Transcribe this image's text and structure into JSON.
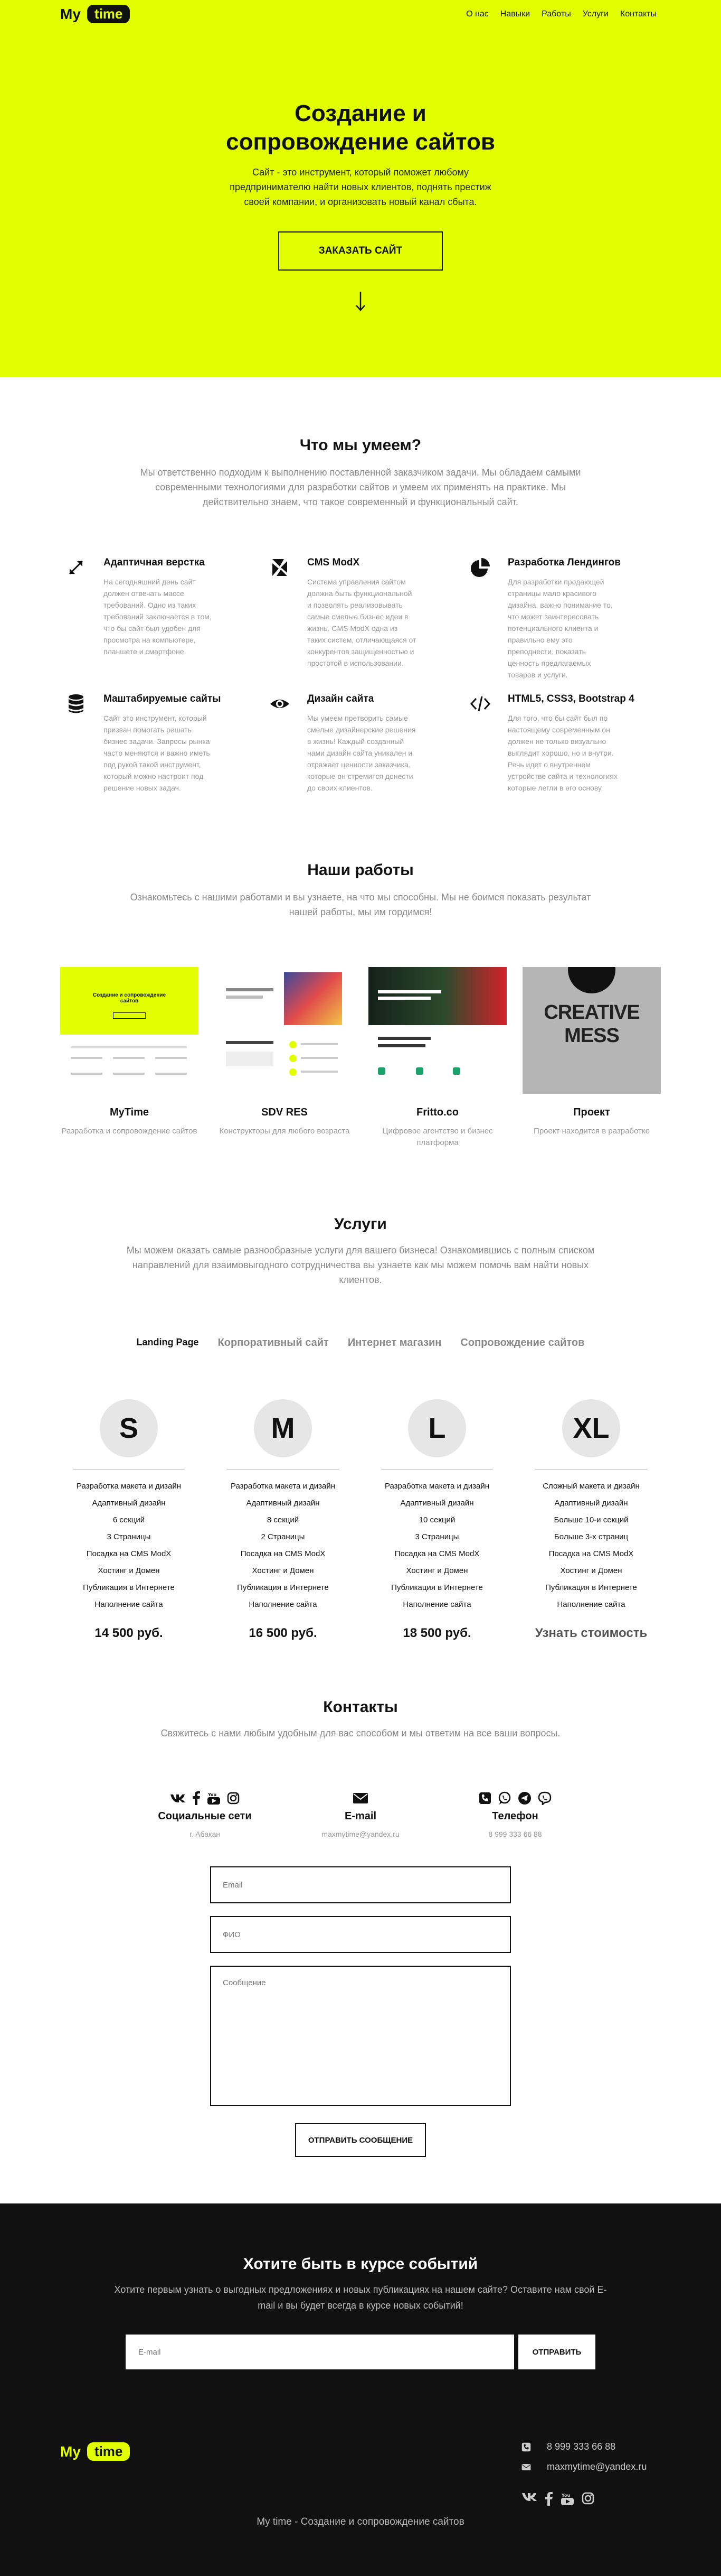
{
  "header": {
    "logo_my": "My",
    "logo_time": "time",
    "nav": [
      "О нас",
      "Навыки",
      "Работы",
      "Услуги",
      "Контакты"
    ]
  },
  "hero": {
    "title_line1": "Создание и",
    "title_line2": "сопровождение сайтов",
    "subtitle": "Сайт - это инструмент, который поможет любому предпринимателю найти новых клиентов, поднять престиж своей компании, и организовать новый канал сбыта.",
    "cta": "ЗАКАЗАТЬ САЙТ",
    "arrow_icon": "arrow-down-icon"
  },
  "skills": {
    "title": "Что мы умеем?",
    "subtitle": "Мы ответственно подходим к выполнению поставленной заказчиком задачи. Мы обладаем самыми современными технологиями для разработки сайтов и умеем их применять на практике. Мы действительно знаем, что такое современный и функциональный сайт.",
    "items": [
      {
        "icon": "expand-arrows-icon",
        "title": "Адаптичная верстка",
        "text": "На сегодняшний день сайт должен отвечать массе требований. Одно из таких требований заключается в том, что бы сайт был удобен для просмотра на компьютере, планшете и смартфоне."
      },
      {
        "icon": "modx-icon",
        "title": "CMS ModX",
        "text": "Система управления сайтом должна быть функциональной и позволять реализовывать самые смелые бизнес идеи в жизнь. CMS ModX одна из таких систем, отличающаяся от конкурентов защищенностью и простотой в использовании."
      },
      {
        "icon": "pie-chart-icon",
        "title": "Разработка Лендингов",
        "text": "Для разработки продающей страницы мало красивого дизайна, важно понимание то, что может заинтересовать потенциального клиента и правильно ему это преподнести, показать ценность предлагаемых товаров и услуги."
      },
      {
        "icon": "database-icon",
        "title": "Маштабируемые сайты",
        "text": "Сайт это инструмент, который призван помогать решать бизнес задачи. Запросы рынка часто меняются и важно иметь под рукой такой инструмент, который можно настроит под решение новых задач."
      },
      {
        "icon": "eye-icon",
        "title": "Дизайн сайта",
        "text": "Мы умеем претворить самые смелые дизайнерские решения в жизнь! Каждый созданный нами дизайн сайта уникален и отражает ценности заказчика, которые он стремится донести до своих клиентов."
      },
      {
        "icon": "code-icon",
        "title": "HTML5, CSS3, Bootstrap 4",
        "text": "Для того, что бы сайт был по настоящему современным он должен не только визуально выглядит хорошо, но и внутри. Речь идет о внутреннем устройстве сайта и технологиях которые легли в его основу."
      }
    ]
  },
  "works": {
    "title": "Наши работы",
    "subtitle": "Ознакомьтесь с нашими работами и вы узнаете, на что мы способны. Мы не боимся показать результат нашей работы, мы им гордимся!",
    "items": [
      {
        "name": "MyTime",
        "desc": "Разработка и сопровождение сайтов",
        "thumb_title": "Создание и сопровождение сайтов"
      },
      {
        "name": "SDV RES",
        "desc": "Конструкторы для любого возраста",
        "thumb_title": ""
      },
      {
        "name": "Fritto.co",
        "desc": "Цифровое агентство и бизнес платформа",
        "thumb_title": ""
      },
      {
        "name": "Проект",
        "desc": "Проект находится в разработке",
        "thumb_title": "CREATIVE MESS"
      }
    ]
  },
  "services": {
    "title": "Услуги",
    "subtitle": "Мы можем оказать самые разнообразные услуги для вашего бизнеса! Ознакомившись с полным списком направлений для взаимовыгодного сотрудничества вы узнаете как мы можем помочь вам найти новых клиентов.",
    "tabs": [
      "Landing Page",
      "Корпоративный сайт",
      "Интернет магазин",
      "Сопровождение сайтов"
    ],
    "plans": [
      {
        "size": "S",
        "items": [
          "Разработка макета и дизайн",
          "Адаптивный дизайн",
          "6 секций",
          "3 Страницы",
          "Посадка на CMS ModX",
          "Хостинг и Домен",
          "Публикация в Интернете",
          "Наполнение сайта"
        ],
        "price": "14 500 руб."
      },
      {
        "size": "M",
        "items": [
          "Разработка макета и дизайн",
          "Адаптивный дизайн",
          "8 секций",
          "2 Страницы",
          "Посадка на CMS ModX",
          "Хостинг и Домен",
          "Публикация в Интернете",
          "Наполнение сайта"
        ],
        "price": "16 500 руб."
      },
      {
        "size": "L",
        "items": [
          "Разработка макета и дизайн",
          "Адаптивный дизайн",
          "10 секций",
          "3 Страницы",
          "Посадка на CMS ModX",
          "Хостинг и Домен",
          "Публикация в Интернете",
          "Наполнение сайта"
        ],
        "price": "18 500 руб."
      },
      {
        "size": "XL",
        "items": [
          "Сложный макета и дизайн",
          "Адаптивный дизайн",
          "Больше 10-и секций",
          "Больше 3-х страниц",
          "Посадка на CMS ModX",
          "Хостинг и Домен",
          "Публикация в Интернете",
          "Наполнение сайта"
        ],
        "price": "Узнать стоимость"
      }
    ]
  },
  "contacts": {
    "title": "Контакты",
    "subtitle": "Свяжитесь с нами любым удобным для вас способом и мы ответим на все ваши вопросы.",
    "social": {
      "title": "Социальные сети",
      "value": "г. Абакан",
      "icons": [
        "vk-icon",
        "facebook-icon",
        "youtube-icon",
        "instagram-icon"
      ]
    },
    "email": {
      "title": "E-mail",
      "value": "maxmytime@yandex.ru",
      "icon": "envelope-icon"
    },
    "phone": {
      "title": "Телефон",
      "value": "8 999 333 66 88",
      "icons": [
        "phone-icon",
        "whatsapp-icon",
        "telegram-icon",
        "viber-icon"
      ]
    },
    "form": {
      "email_placeholder": "Email",
      "name_placeholder": "ФИО",
      "message_placeholder": "Сообщение",
      "submit": "ОТПРАВИТЬ СООБЩЕНИЕ"
    }
  },
  "newsletter": {
    "title": "Хотите быть в курсе событий",
    "subtitle": "Хотите первым узнать о выгодных предложениях и новых публикациях на нашем сайте? Оставите нам свой E-mail и вы будет всегда в курсе новых событий!",
    "placeholder": "E-mail",
    "submit": "ОТПРАВИТЬ"
  },
  "footer": {
    "logo_my": "My",
    "logo_time": "time",
    "phone": "8 999 333 66 88",
    "email": "maxmytime@yandex.ru",
    "copyright": "My time - Создание и сопровождение сайтов"
  },
  "colors": {
    "accent": "#e1ff00",
    "dark": "#111111",
    "muted": "#999999"
  }
}
